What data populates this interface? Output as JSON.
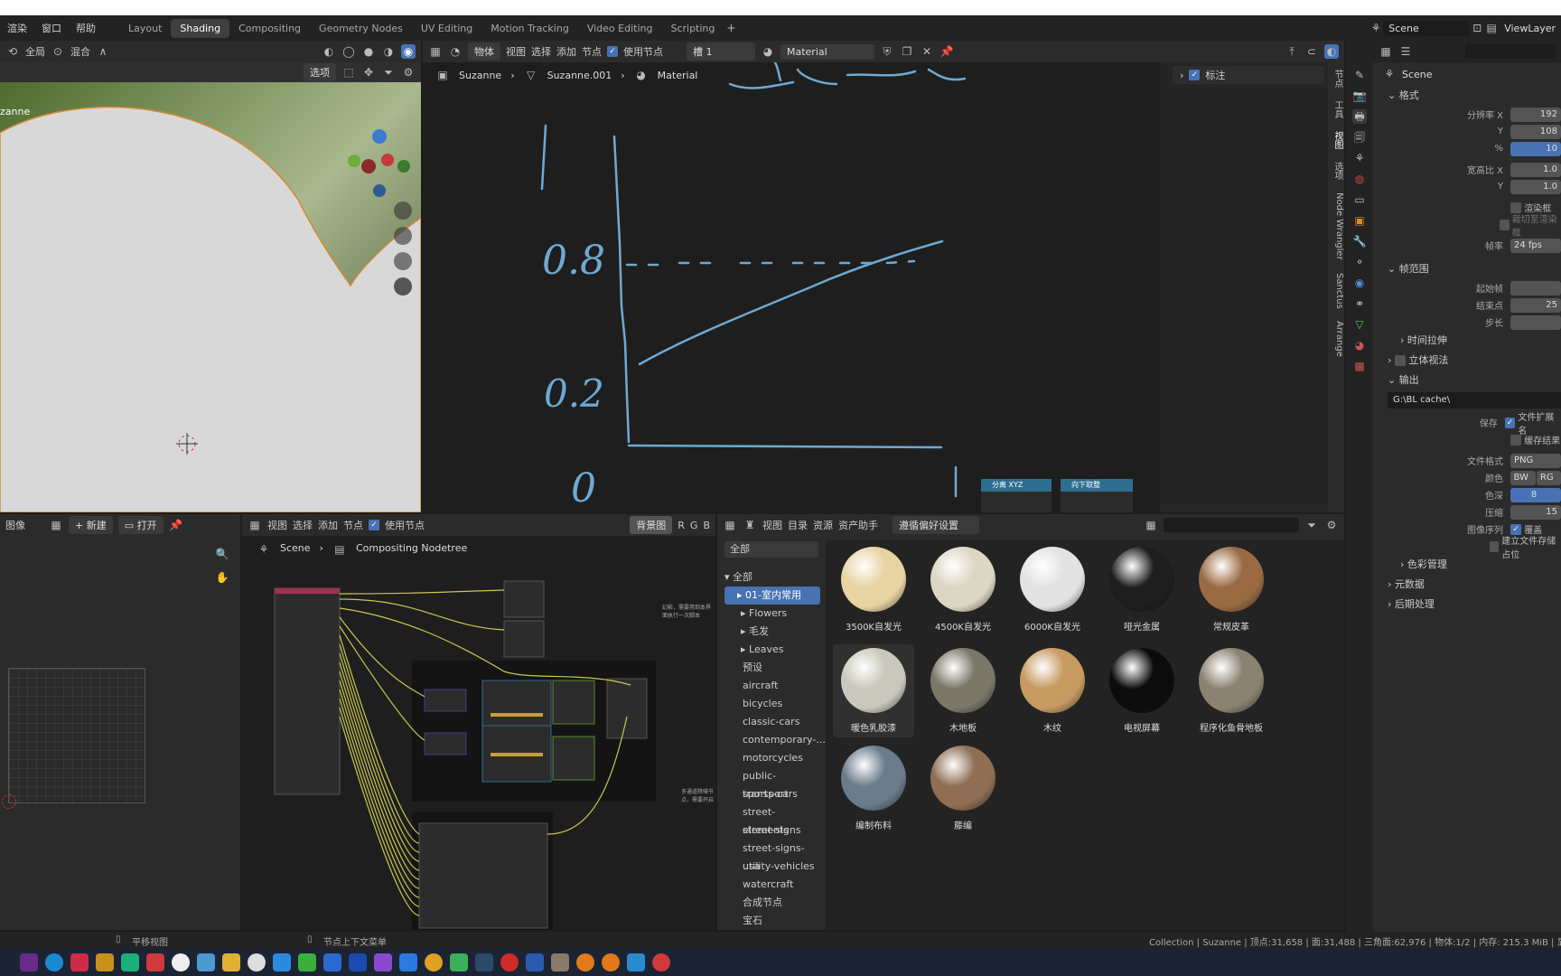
{
  "menus": [
    "渲染",
    "窗口",
    "帮助"
  ],
  "workspace_tabs": [
    "Layout",
    "Shading",
    "Compositing",
    "Geometry Nodes",
    "UV Editing",
    "Motion Tracking",
    "Video Editing",
    "Scripting"
  ],
  "active_tab": "Shading",
  "scene_name": "Scene",
  "viewlayer": "ViewLayer",
  "viewport": {
    "mode": "全局",
    "blend": "混合",
    "options": "选项",
    "object_label": "zanne"
  },
  "node_editor": {
    "header": {
      "object": "物体",
      "view": "视图",
      "select": "选择",
      "add": "添加",
      "node": "节点",
      "use_nodes": "使用节点",
      "slot": "槽 1",
      "material": "Material"
    },
    "breadcrumb": [
      "Suzanne",
      "Suzanne.001",
      "Material"
    ],
    "annotations": {
      "l1": "0.8",
      "l2": "0.2",
      "l3": "0"
    },
    "node_labels": [
      "分离 XYZ",
      "向下取整"
    ],
    "sidebar_label": "标注",
    "side_tabs": [
      "节点",
      "工具",
      "视图",
      "选项",
      "Node Wrangler",
      "Sanctus",
      "Arrange"
    ]
  },
  "image_editor": {
    "label": "图像",
    "new": "新建",
    "open": "打开"
  },
  "compositor": {
    "view": "视图",
    "select": "选择",
    "add": "添加",
    "node": "节点",
    "use_nodes": "使用节点",
    "backdrop": "背景图",
    "channels": [
      "R",
      "G",
      "B"
    ],
    "breadcrumb": [
      "Scene",
      "Compositing Nodetree"
    ],
    "frame1": "幻影，需要用到本界面执行一次脚本",
    "frame2": "多通道降噪节点，需要开启"
  },
  "asset_browser": {
    "view": "视图",
    "catalog": "目录",
    "assets": "资源",
    "helper": "资产助手",
    "prefs": "遵循偏好设置",
    "filter": "全部",
    "tree": [
      "全部",
      "01-室内常用",
      "Flowers",
      "毛发",
      "Leaves",
      "预设",
      "aircraft",
      "bicycles",
      "classic-cars",
      "contemporary-...",
      "motorcycles",
      "public-transport",
      "sports-cars",
      "street-elements",
      "street-signs",
      "street-signs-usa",
      "utility-vehicles",
      "watercraft",
      "合成节点",
      "宝石"
    ],
    "materials": [
      {
        "name": "3500K自发光",
        "color": "#e8d3a3"
      },
      {
        "name": "4500K自发光",
        "color": "#dcd6c4"
      },
      {
        "name": "6000K自发光",
        "color": "#e2e2e2"
      },
      {
        "name": "哑光金属",
        "color": "#1e1e1e"
      },
      {
        "name": "常规皮革",
        "color": "#9a6a42"
      },
      {
        "name": "暖色乳胶漆",
        "color": "#c9c8bb"
      },
      {
        "name": "木地板",
        "color": "#7b7769"
      },
      {
        "name": "木纹",
        "color": "#c79a62"
      },
      {
        "name": "电视屏幕",
        "color": "#0c0c0c"
      },
      {
        "name": "程序化鱼骨地板",
        "color": "#8c8271"
      },
      {
        "name": "编制布料",
        "color": "#6a7b8a"
      },
      {
        "name": "藤编",
        "color": "#8f6e54"
      }
    ]
  },
  "properties": {
    "scene": "Scene",
    "format": "格式",
    "res_x_label": "分辨率 X",
    "res_x": "192",
    "y_label": "Y",
    "res_y": "108",
    "pct_label": "%",
    "pct": "10",
    "aspect_x_label": "宽高比 X",
    "aspect_x": "1.0",
    "aspect_y": "1.0",
    "render_region": "渲染框",
    "crop": "裁切至渲染框",
    "fps_label": "帧率",
    "fps": "24 fps",
    "frame_range": "帧范围",
    "start_label": "起始帧",
    "end_label": "结束点",
    "step_label": "步长",
    "end_val": "25",
    "time_stretch": "时间拉伸",
    "stereo": "立体视法",
    "output": "输出",
    "output_path": "G:\\BL cache\\",
    "save_label": "保存",
    "file_ext": "文件扩展名",
    "cache_result": "缓存结果",
    "file_format_label": "文件格式",
    "file_format": "PNG",
    "color_label": "颜色",
    "color_bw": "BW",
    "color_rg": "RG",
    "depth_label": "色深",
    "depth": "8",
    "compress_label": "压缩",
    "compress": "15",
    "image_seq_label": "图像序列",
    "overwrite": "覆盖",
    "placeholders": "建立文件存储占位",
    "color_mgmt": "色彩管理",
    "metadata": "元数据",
    "post": "后期处理"
  },
  "status": {
    "left": "平移视图",
    "middle": "节点上下文菜单",
    "right": "Collection | Suzanne | 顶点:31,658 | 面:31,488 | 三角面:62,976 | 物体:1/2 | 内存: 215.3 MiB | 显存: 4"
  }
}
